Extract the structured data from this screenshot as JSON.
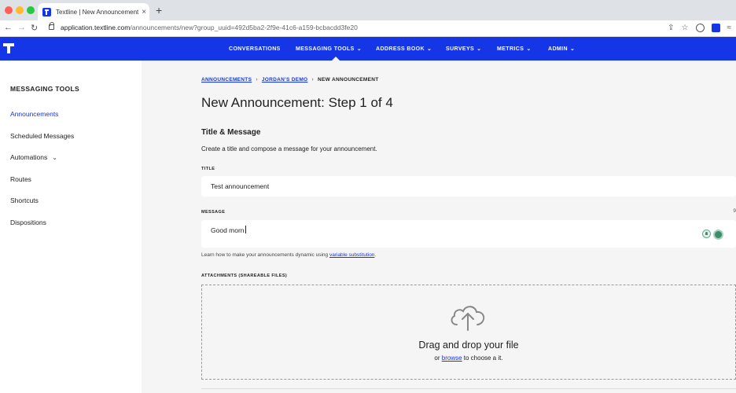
{
  "browser": {
    "tab_title": "Textline | New Announcement",
    "tab_close": "×",
    "new_tab": "+",
    "url_host": "application.textline.com",
    "url_path": "/announcements/new?group_uuid=492d5ba2-2f9e-41c6-a159-bcbacdd3fe20",
    "nav_icons": [
      "back-arrow-icon",
      "forward-arrow-icon",
      "reload-icon",
      "lock-icon"
    ],
    "toolbar_icons": [
      "share-icon",
      "star-icon",
      "password-extension-icon",
      "textline-extension-icon",
      "profile-icon"
    ]
  },
  "appnav": {
    "logo_icon": "textline-logo-icon",
    "items": [
      {
        "label": "CONVERSATIONS",
        "dropdown": false
      },
      {
        "label": "MESSAGING TOOLS",
        "dropdown": true,
        "active": true
      },
      {
        "label": "ADDRESS BOOK",
        "dropdown": true
      },
      {
        "label": "SURVEYS",
        "dropdown": true
      },
      {
        "label": "METRICS",
        "dropdown": true
      },
      {
        "label": "ADMIN",
        "dropdown": true
      }
    ],
    "accent_color": "#1436e6"
  },
  "sidebar": {
    "title": "MESSAGING TOOLS",
    "items": [
      {
        "label": "Announcements",
        "active": true
      },
      {
        "label": "Scheduled Messages"
      },
      {
        "label": "Automations",
        "dropdown": true
      },
      {
        "label": "Routes"
      },
      {
        "label": "Shortcuts"
      },
      {
        "label": "Dispositions"
      }
    ]
  },
  "main": {
    "breadcrumb": {
      "items": [
        "ANNOUNCEMENTS",
        "JORDAN'S DEMO",
        "NEW ANNOUNCEMENT"
      ],
      "separator": "›"
    },
    "page_title": "New Announcement: Step 1 of 4",
    "section_title": "Title & Message",
    "section_desc": "Create a title and compose a message for your announcement.",
    "title_label": "TITLE",
    "title_value": "Test announcement",
    "message_label": "MESSAGE",
    "message_value": "Good morn",
    "message_counter": "9",
    "message_icons": [
      "lightbulb-icon",
      "avatar-icon"
    ],
    "help_prefix": "Learn how to make your announcements dynamic using ",
    "help_link": "variable substitution",
    "help_suffix": ".",
    "attachments_label": "ATTACHMENTS (SHAREABLE FILES)",
    "dropzone_icon": "cloud-upload-icon",
    "dropzone_title": "Drag and drop your file",
    "dropzone_sub_prefix": "or ",
    "dropzone_sub_link": "browse",
    "dropzone_sub_suffix": " to choose a it."
  }
}
